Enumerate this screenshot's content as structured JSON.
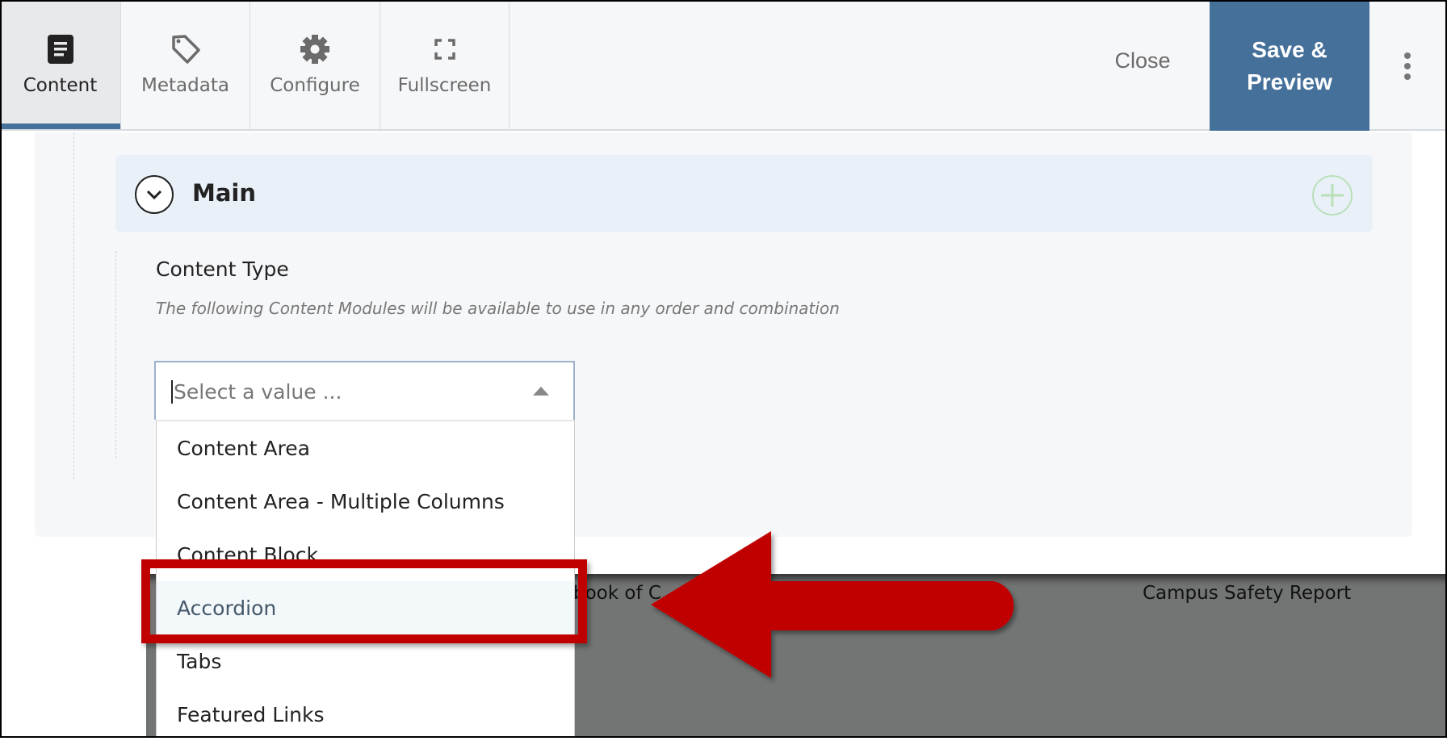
{
  "toolbar": {
    "tabs": [
      {
        "label": "Content",
        "icon": "document-icon",
        "active": true
      },
      {
        "label": "Metadata",
        "icon": "tag-icon"
      },
      {
        "label": "Configure",
        "icon": "gear-icon"
      },
      {
        "label": "Fullscreen",
        "icon": "fullscreen-icon"
      }
    ],
    "close_label": "Close",
    "save_label": "Save & Preview",
    "more_icon": "kebab-icon"
  },
  "section": {
    "title": "Main",
    "collapse_icon": "chevron-down-circle-icon",
    "add_icon": "plus-circle-icon"
  },
  "field": {
    "label": "Content Type",
    "description": "The following Content Modules will be available to use in any order and combination",
    "placeholder": "Select a value ...",
    "options": [
      "Content Area",
      "Content Area - Multiple Columns",
      "Content Block",
      "Accordion",
      "Tabs",
      "Featured Links"
    ],
    "highlighted": "Accordion"
  },
  "background": {
    "footer_text_left": "book of C",
    "footer_text_right": "Campus Safety Report"
  },
  "annotation": {
    "color": "#c00000",
    "shape": "arrow-and-box",
    "target": "Accordion"
  },
  "colors": {
    "accent": "#44709a",
    "add": "#b9e0b9"
  }
}
